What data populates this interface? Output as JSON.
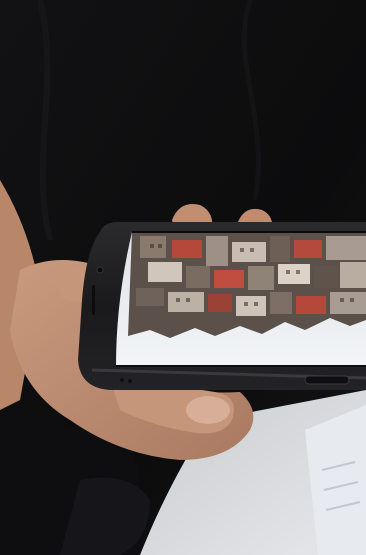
{
  "scene": {
    "description_tag": "photo",
    "colors": {
      "shirt": "#101012",
      "skin": "#c99a7e",
      "skin_shadow": "#a97a61",
      "phone_body": "#1a1a1c",
      "phone_edge": "#2b2b2e",
      "sky": "#eef1f4",
      "floor": "#d9dcdf",
      "paper": "#e3e6ea",
      "buildings_dark": "#3a3530",
      "buildings_mid": "#7a6a5e",
      "buildings_light": "#b9aca1",
      "roof_red": "#b5483a"
    },
    "phone": {
      "orientation": "landscape",
      "screen_content": "upside-down-cityscape",
      "camera_icon": "camera-icon",
      "speaker_icon": "speaker-grille-icon",
      "lightning_port_icon": "charging-port-icon"
    }
  }
}
